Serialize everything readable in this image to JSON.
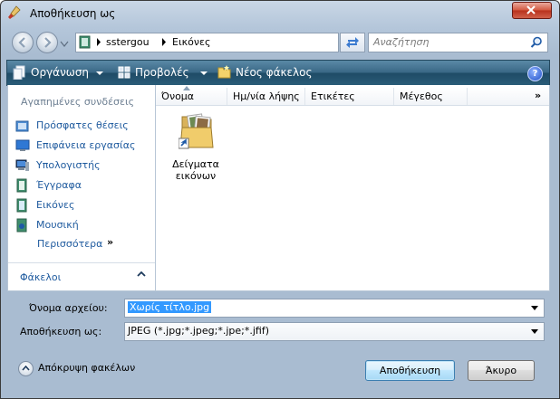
{
  "window": {
    "title": "Αποθήκευση ως"
  },
  "address": {
    "crumbs": [
      "sstergou",
      "Εικόνες"
    ]
  },
  "search": {
    "placeholder": "Αναζήτηση"
  },
  "toolbar": {
    "organize": "Οργάνωση",
    "views": "Προβολές",
    "new_folder": "Νέος φάκελος",
    "help": "?"
  },
  "nav": {
    "favorites_header": "Αγαπημένες συνδέσεις",
    "items": [
      {
        "label": "Πρόσφατες θέσεις",
        "icon": "recent-places-icon"
      },
      {
        "label": "Επιφάνεια εργασίας",
        "icon": "desktop-icon"
      },
      {
        "label": "Υπολογιστής",
        "icon": "computer-icon"
      },
      {
        "label": "Έγγραφα",
        "icon": "documents-icon"
      },
      {
        "label": "Εικόνες",
        "icon": "pictures-icon"
      },
      {
        "label": "Μουσική",
        "icon": "music-icon"
      }
    ],
    "more": "Περισσότερα",
    "more_chevron": "»",
    "folders_header": "Φάκελοι"
  },
  "file_list": {
    "columns": [
      "Όνομα",
      "Ημ/νία λήψης",
      "Ετικέτες",
      "Μέγεθος"
    ],
    "more": "»",
    "items": [
      {
        "label_line1": "Δείγματα",
        "label_line2": "εικόνων",
        "icon": "sample-pictures-folder-icon"
      }
    ]
  },
  "form": {
    "filename_label": "Όνομα αρχείου:",
    "filename_value": "Χωρίς τίτλο.jpg",
    "savetype_label": "Αποθήκευση ως:",
    "savetype_value": "JPEG (*.jpg;*.jpeg;*.jpe;*.jfif)"
  },
  "footer": {
    "hide_folders": "Απόκρυψη φακέλων",
    "save": "Αποθήκευση",
    "cancel": "Άκυρο"
  }
}
